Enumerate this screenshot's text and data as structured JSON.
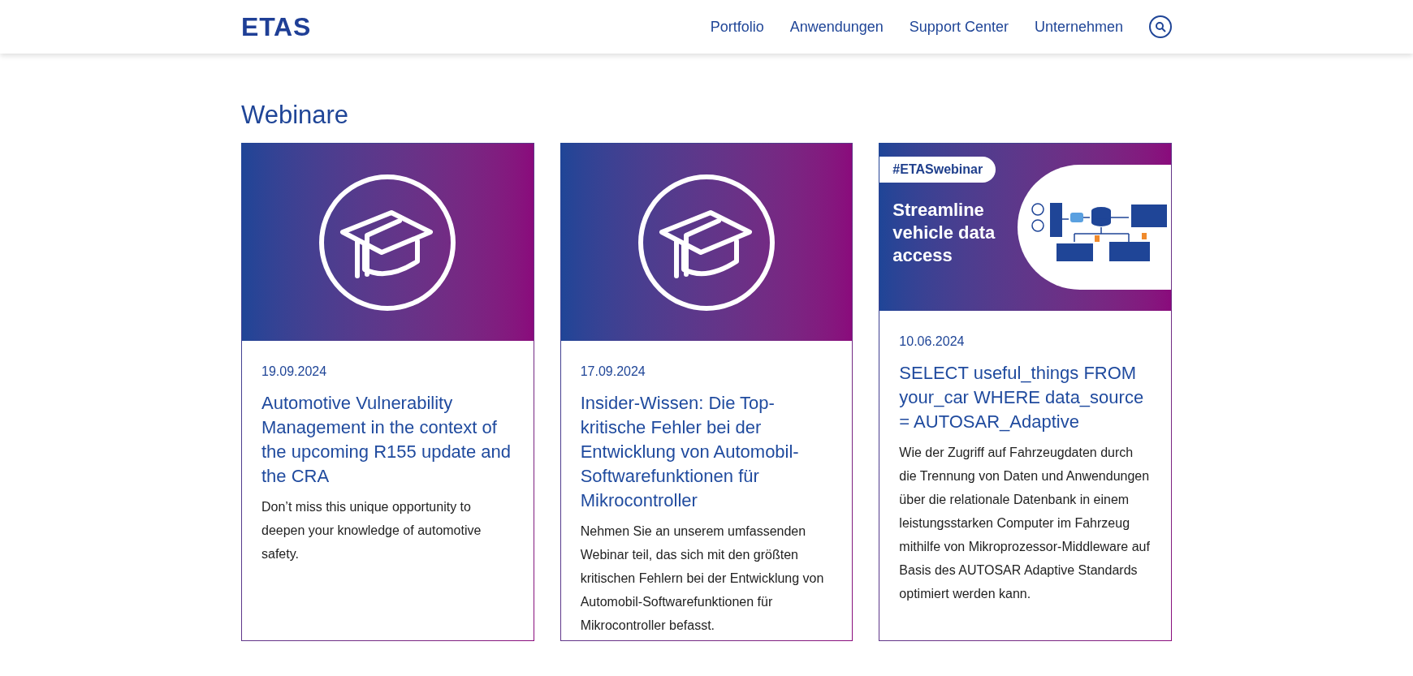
{
  "header": {
    "logo": "ETAS",
    "nav": [
      {
        "label": "Portfolio"
      },
      {
        "label": "Anwendungen"
      },
      {
        "label": "Support Center"
      },
      {
        "label": "Unternehmen"
      }
    ]
  },
  "page_title": "Webinare",
  "cards": [
    {
      "kind": "icon",
      "date": "19.09.2024",
      "title": "Automotive Vulnerability Management in the context of the upcoming R155 update and the CRA",
      "text": "Don’t miss this unique opportunity to deepen your knowledge of automotive safety."
    },
    {
      "kind": "icon",
      "date": "17.09.2024",
      "title": "Insider-Wissen: Die Top-kritische Fehler bei der Entwicklung von Automobil-Softwarefunktionen für Mikrocontroller",
      "text": "Nehmen Sie an unserem umfassenden Webinar teil, das sich mit den größten kritischen Fehlern bei der Entwicklung von Automobil-Softwarefunktionen für Mikrocontroller befasst."
    },
    {
      "kind": "banner",
      "tag": "#ETASwebinar",
      "headline": "Streamline vehicle data access",
      "date": "10.06.2024",
      "title": "SELECT useful_things FROM your_car WHERE data_source = AUTOSAR_Adaptive",
      "text": "Wie der Zugriff auf Fahrzeugdaten durch die Trennung von Daten und Anwendungen über die relationale Datenbank in einem leistungsstarken Computer im Fahrzeug mithilfe von Mikroprozessor-Middleware auf Basis des AUTOSAR Adaptive Standards optimiert werden kann."
    }
  ]
}
